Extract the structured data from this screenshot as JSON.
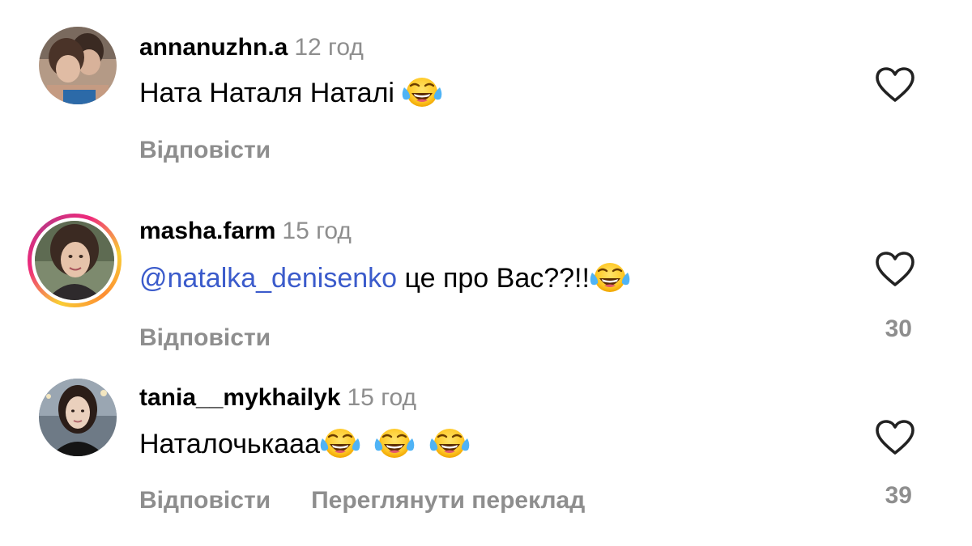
{
  "comments": [
    {
      "username": "annanuzhn.a",
      "time": "12 год",
      "text": "Ната Наталя Наталі",
      "emoji_icon": "face-with-tears-of-joy-icon",
      "emoji_count": 1,
      "reply_label": "Відповісти",
      "likes": "",
      "has_story": false
    },
    {
      "username": "masha.farm",
      "time": "15 год",
      "mention": "@natalka_denisenko",
      "text": " це про Вас??!!",
      "emoji_icon": "face-with-tears-of-joy-icon",
      "emoji_count": 1,
      "reply_label": "Відповісти",
      "likes": "30",
      "has_story": true
    },
    {
      "username": "tania__mykhailyk",
      "time": "15 год",
      "text": "Наталочькааа",
      "emoji_icon": "face-with-tears-of-joy-icon",
      "emoji_count": 3,
      "reply_label": "Відповісти",
      "translate_label": "Переглянути переклад",
      "likes": "39",
      "has_story": false
    }
  ],
  "colors": {
    "secondary_text": "#8e8e8e",
    "mention": "#3b5bcb",
    "story_ring_start": "#f9ce34",
    "story_ring_mid": "#ee2a7b"
  }
}
